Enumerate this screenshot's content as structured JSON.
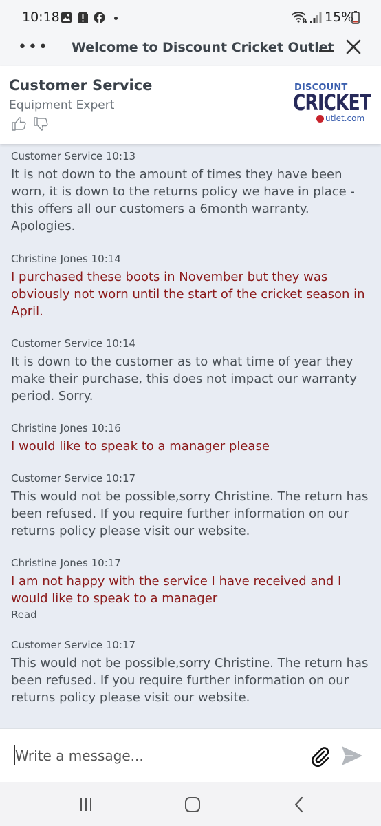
{
  "status_bar": {
    "time": "10:18",
    "battery": "15%",
    "icons": [
      "gallery-icon",
      "alert-icon",
      "facebook-icon",
      "wifi-icon",
      "signal-icon",
      "battery-icon"
    ]
  },
  "window": {
    "title": "Welcome to Discount Cricket Outlet",
    "menu": "•••"
  },
  "agent": {
    "name": "Customer Service",
    "role": "Equipment Expert"
  },
  "logo": {
    "line1": "DISCOUNT",
    "line2": "CRICKET",
    "line3": "utlet.com",
    "colors": {
      "navy": "#272a5a",
      "blue": "#3b5fae",
      "red": "#c8232c"
    }
  },
  "messages": [
    {
      "meta": "Customer Service 10:13",
      "text": "It is not down to the amount of times they have been worn, it is down to the returns policy we have in place - this offers all our customers a 6month warranty. Apologies."
    },
    {
      "meta": "Christine Jones 10:14",
      "text": "I purchased these boots in November but they was obviously not worn until the start of the cricket season in April."
    },
    {
      "meta": "Customer Service 10:14",
      "text": "It is down to the customer as to what time of year they make their purchase, this does not impact our warranty period. Sorry."
    },
    {
      "meta": "Christine Jones 10:16",
      "text": "I would like to speak to a manager please"
    },
    {
      "meta": "Customer Service 10:17",
      "text": "This would not be possible,sorry Christine. The return has been refused. If you require further information on our returns policy please visit our website."
    },
    {
      "meta": "Christine Jones 10:17",
      "text": "I am not happy with the service I have received and I would like to speak to a manager",
      "status": "Read"
    },
    {
      "meta": "Customer Service 10:17",
      "text": "This would not be possible,sorry Christine. The return has been refused. If you require further information on our returns policy please visit our website."
    }
  ],
  "composer": {
    "placeholder": "Write a message...",
    "value": ""
  },
  "colors": {
    "chat_bg": "#e8ecf3",
    "agent_text": "#4a5157",
    "customer_text": "#8b1a1a"
  }
}
